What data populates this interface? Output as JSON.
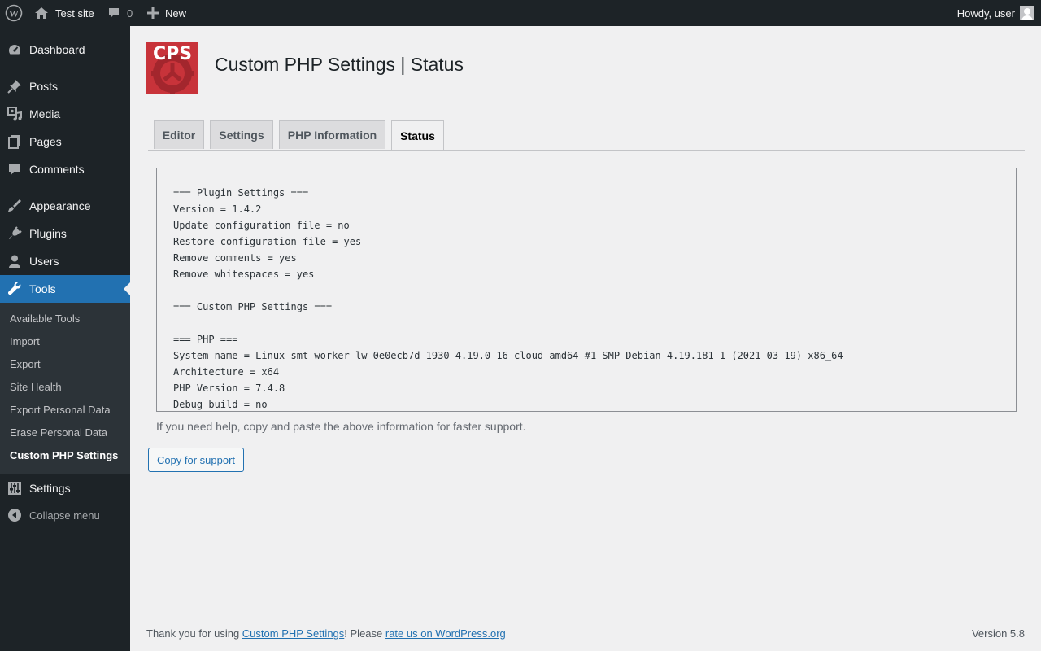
{
  "admin_bar": {
    "site_name": "Test site",
    "comments_count": "0",
    "new_label": "New",
    "howdy": "Howdy, user"
  },
  "sidebar": {
    "items": [
      {
        "label": "Dashboard",
        "icon": "dashboard-icon"
      },
      {
        "label": "Posts",
        "icon": "pushpin-icon"
      },
      {
        "label": "Media",
        "icon": "media-icon"
      },
      {
        "label": "Pages",
        "icon": "pages-icon"
      },
      {
        "label": "Comments",
        "icon": "comment-icon"
      },
      {
        "label": "Appearance",
        "icon": "paintbrush-icon"
      },
      {
        "label": "Plugins",
        "icon": "plugin-icon"
      },
      {
        "label": "Users",
        "icon": "users-icon"
      },
      {
        "label": "Tools",
        "icon": "wrench-icon"
      },
      {
        "label": "Settings",
        "icon": "settings-icon"
      }
    ],
    "submenu": [
      "Available Tools",
      "Import",
      "Export",
      "Site Health",
      "Export Personal Data",
      "Erase Personal Data",
      "Custom PHP Settings"
    ],
    "collapse_label": "Collapse menu"
  },
  "logo": {
    "text": "CPS"
  },
  "page_title": "Custom PHP Settings | Status",
  "tabs": [
    "Editor",
    "Settings",
    "PHP Information",
    "Status"
  ],
  "status_lines": [
    "=== Plugin Settings ===",
    "Version = 1.4.2",
    "Update configuration file = no",
    "Restore configuration file = yes",
    "Remove comments = yes",
    "Remove whitespaces = yes",
    "",
    "=== Custom PHP Settings ===",
    "",
    "=== PHP ===",
    "System name = Linux smt-worker-lw-0e0ecb7d-1930 4.19.0-16-cloud-amd64 #1 SMP Debian 4.19.181-1 (2021-03-19) x86_64",
    "Architecture = x64",
    "PHP Version = 7.4.8",
    "Debug build = no"
  ],
  "help_text": "If you need help, copy and paste the above information for faster support.",
  "copy_button": "Copy for support",
  "footer": {
    "thanks_prefix": "Thank you for using ",
    "plugin_link": "Custom PHP Settings",
    "please": "! Please ",
    "rate_link": "rate us on WordPress.org",
    "version": "Version 5.8"
  },
  "colors": {
    "accent": "#2271b1",
    "sidebar_bg": "#1d2327",
    "logo_bg": "#c8333a"
  }
}
